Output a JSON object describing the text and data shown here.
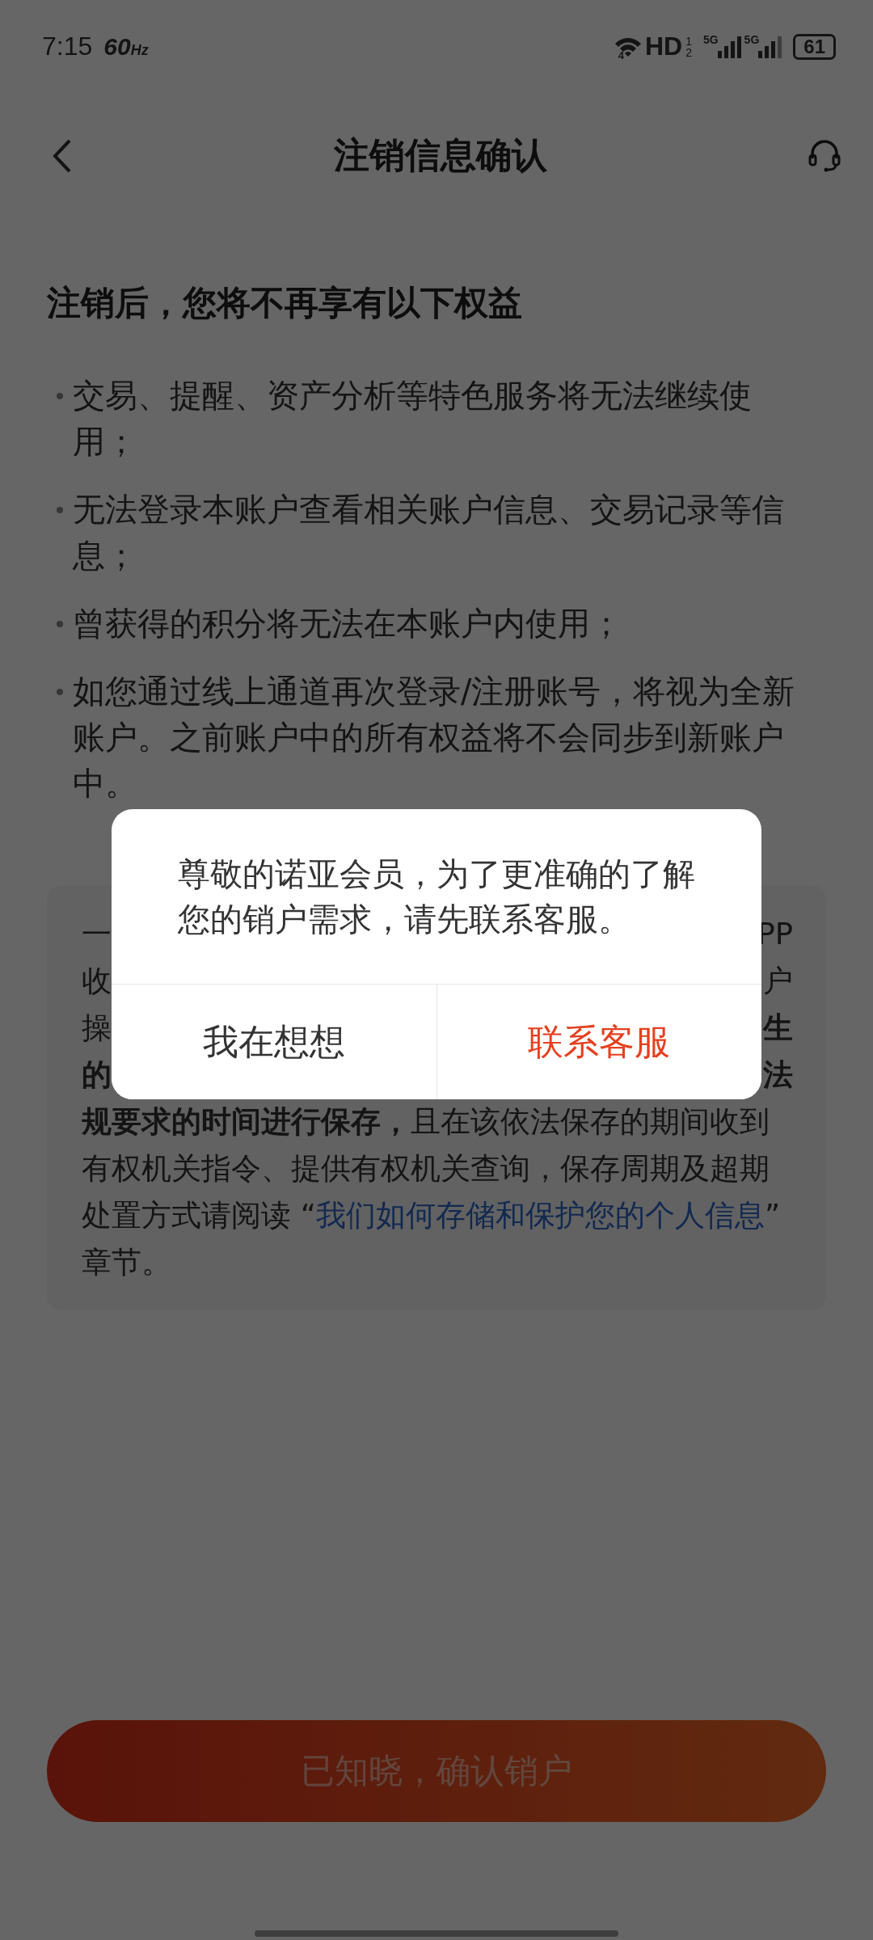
{
  "status_bar": {
    "time": "7:15",
    "refresh_rate": "60",
    "refresh_unit": "Hz",
    "wifi_label": "4",
    "hd_label": "HD",
    "hd_sims": [
      "1",
      "2"
    ],
    "signals": [
      {
        "label": "5G"
      },
      {
        "label": "5G"
      }
    ],
    "battery": "61"
  },
  "header": {
    "title": "注销信息确认"
  },
  "heading": "注销后，您将不再享有以下权益",
  "bullets": [
    "交易、提醒、资产分析等特色服务将无法继续使用；",
    "无法登录本账户查看相关账户信息、交易记录等信息；",
    "曾获得的积分将无法在本账户内使用；",
    "如您通过线上通道再次登录/注册账号，将视为全新账户。之前账户中的所有权益将不会同步到新账户中。"
  ],
  "notice_card": {
    "clipped_lines": [
      {
        "start": {
          "text": "一",
          "bold": false
        },
        "end": {
          "text": "PP",
          "bold": false
        }
      },
      {
        "start": {
          "text": "收",
          "bold": false
        },
        "end": {
          "text": "户",
          "bold": false
        }
      },
      {
        "start": {
          "text": "操",
          "bold": false
        },
        "end": {
          "text": "生",
          "bold": true
        }
      },
      {
        "start": {
          "text": "的",
          "bold": true
        },
        "end": {
          "text": "法",
          "bold": true
        }
      }
    ],
    "text": "**规要求的时间进行保存，**且在该依法保存的期间收到有权机关指令、提供有权机关查询，保存周期及超期处置方式请阅读 “",
    "link": "我们如何存储和保护您的个人信息",
    "text_after": "” 章节。"
  },
  "confirm_button": "已知晓，确认销户",
  "dialog": {
    "message": "尊敬的诺亚会员，为了更准确的了解您的销户需求，请先联系客服。",
    "buttons": [
      {
        "label": "我在想想",
        "kind": "secondary"
      },
      {
        "label": "联系客服",
        "kind": "primary"
      }
    ]
  }
}
